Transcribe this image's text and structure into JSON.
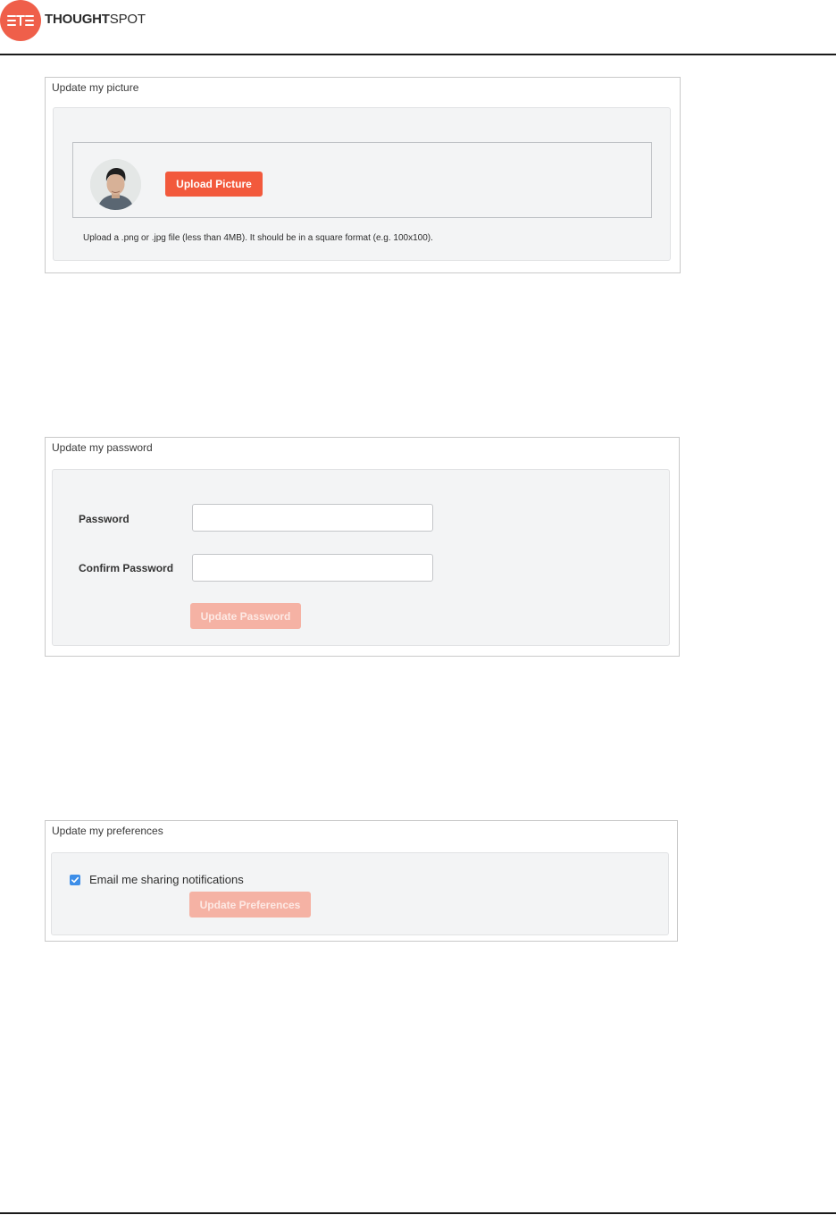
{
  "header": {
    "logo_bold": "THOUGHT",
    "logo_light": "SPOT"
  },
  "picture_section": {
    "title": "Update my picture",
    "upload_button": "Upload Picture",
    "help_text": "Upload a .png or .jpg file (less than 4MB). It should be in a square format (e.g. 100x100)."
  },
  "password_section": {
    "title": "Update my password",
    "password_label": "Password",
    "password_value": "",
    "confirm_label": "Confirm Password",
    "confirm_value": "",
    "submit_button": "Update Password"
  },
  "preferences_section": {
    "title": "Update my preferences",
    "email_notifications_label": "Email me sharing notifications",
    "email_notifications_checked": true,
    "submit_button": "Update Preferences"
  },
  "colors": {
    "accent": "#f2593c",
    "accent_disabled": "#f5b2a4",
    "checkbox": "#3d8ee8",
    "logo": "#ef5f4a"
  }
}
